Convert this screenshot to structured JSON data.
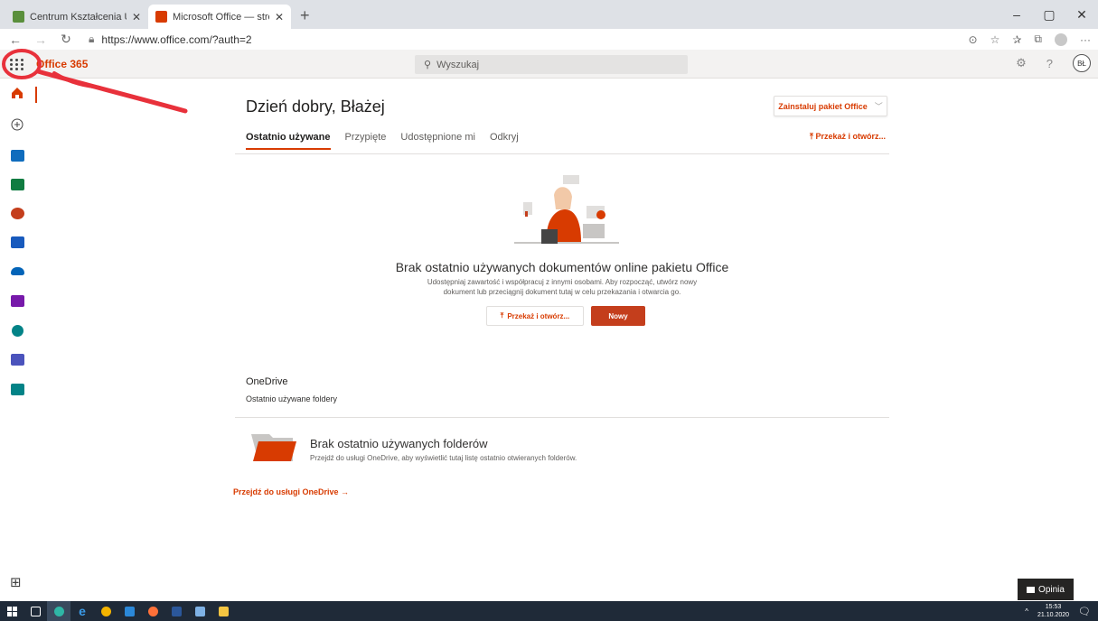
{
  "browser": {
    "tabs": [
      {
        "title": "Centrum Kształcenia Ustawiczne",
        "active": false
      },
      {
        "title": "Microsoft Office — strona główn",
        "active": true
      }
    ],
    "new_tab": "+",
    "url": "https://www.office.com/?auth=2",
    "window_controls": {
      "minimize": "–",
      "maximize": "▢",
      "close": "✕"
    }
  },
  "header": {
    "brand": "Office 365",
    "search_placeholder": "Wyszukaj",
    "user_initials": "BŁ"
  },
  "rail": {
    "apps": [
      {
        "name": "home",
        "color": "#d83b01"
      },
      {
        "name": "create",
        "color": "#444444"
      },
      {
        "name": "outlook",
        "color": "#0f6cbd"
      },
      {
        "name": "excel",
        "color": "#107c41"
      },
      {
        "name": "powerpoint",
        "color": "#c43e1c"
      },
      {
        "name": "word",
        "color": "#185abd"
      },
      {
        "name": "onedrive",
        "color": "#0364b8"
      },
      {
        "name": "onenote",
        "color": "#7719aa"
      },
      {
        "name": "sharepoint",
        "color": "#038387"
      },
      {
        "name": "teams",
        "color": "#4b53bc"
      },
      {
        "name": "sway",
        "color": "#038387"
      }
    ]
  },
  "main": {
    "greeting": "Dzień dobry, Błażej",
    "install_label": "Zainstaluj pakiet Office",
    "tabs": [
      {
        "label": "Ostatnio używane",
        "active": true
      },
      {
        "label": "Przypięte",
        "active": false
      },
      {
        "label": "Udostępnione mi",
        "active": false
      },
      {
        "label": "Odkryj",
        "active": false
      }
    ],
    "upload_open": "Przekaż i otwórz...",
    "empty_title": "Brak ostatnio używanych dokumentów online pakietu Office",
    "empty_desc_line1": "Udostępniaj zawartość i współpracuj z innymi osobami. Aby rozpocząć, utwórz nowy",
    "empty_desc_line2": "dokument lub przeciągnij dokument tutaj w celu przekazania i otwarcia go.",
    "upload_button": "Przekaż i otwórz...",
    "new_button": "Nowy"
  },
  "onedrive": {
    "title": "OneDrive",
    "subtitle": "Ostatnio używane foldery",
    "no_folders_title": "Brak ostatnio używanych folderów",
    "no_folders_desc": "Przejdź do usługi OneDrive, aby wyświetlić tutaj listę ostatnio otwieranych folderów.",
    "go_link": "Przejdź do usługi OneDrive"
  },
  "feedback": "Opinia",
  "taskbar": {
    "time": "15:53",
    "date": "21.10.2020"
  },
  "colors": {
    "accent": "#d83b01",
    "new_button": "#c43e1c",
    "annotation": "#e8313b"
  }
}
